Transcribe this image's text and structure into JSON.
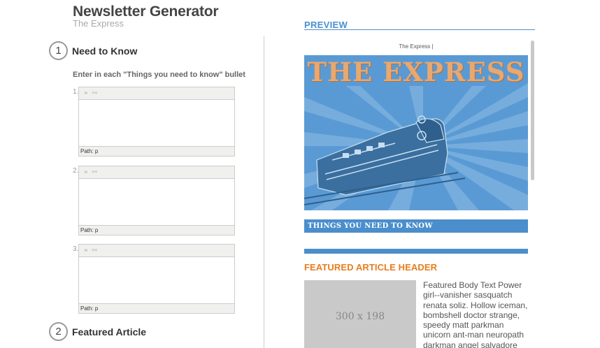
{
  "app": {
    "title": "Newsletter Generator",
    "subtitle": "The Express"
  },
  "steps": [
    {
      "number": "1",
      "label": "Need to Know"
    },
    {
      "number": "2",
      "label": "Featured Article"
    }
  ],
  "need_to_know": {
    "instructions": "Enter in each \"Things you need to know\" bullet",
    "bullets": [
      {
        "number": "1.",
        "path": "Path: p"
      },
      {
        "number": "2.",
        "path": "Path: p"
      },
      {
        "number": "3.",
        "path": "Path: p"
      }
    ],
    "toolbar_icons": [
      "link-icon",
      "unlink-icon"
    ]
  },
  "preview": {
    "label": "PREVIEW",
    "header_text": "The Express |",
    "banner_title": "THE EXPRESS",
    "things_heading": "THINGS YOU NEED TO KNOW",
    "featured_header": "FEATURED ARTICLE HEADER",
    "image_placeholder": "300 x 198",
    "featured_body": "Featured Body Text Power girl--vanisher sasquatch renata soliz. Hollow iceman, bombshell doctor strange, speedy matt parkman unicorn ant-man neuropath darkman angel salvadore namora karnak"
  },
  "colors": {
    "accent_blue": "#4a8fd0",
    "featured_orange": "#e87d1e",
    "banner_blue": "#5a9ad4",
    "banner_title": "#e8a870"
  }
}
